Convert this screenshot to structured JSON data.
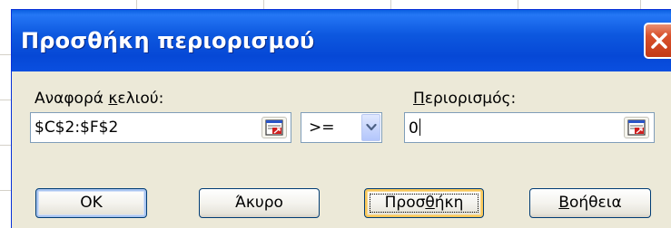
{
  "dialog": {
    "title": "Προσθήκη περιορισμού"
  },
  "cell_reference": {
    "label_pre": "Αναφορά ",
    "label_accel": "κ",
    "label_post": "ελιού:",
    "value": "$C$2:$F$2"
  },
  "operator": {
    "selected": ">="
  },
  "constraint": {
    "label_accel": "Π",
    "label_post": "εριορισμός:",
    "value": "0"
  },
  "buttons": {
    "ok": "OK",
    "cancel": "Άκυρο",
    "add_pre": "Προσ",
    "add_accel": "θ",
    "add_post": "ήκη",
    "help_accel": "Β",
    "help_post": "οήθεια"
  },
  "colors": {
    "titlebar": "#0a4fe0",
    "close_button": "#d9512c",
    "dialog_face": "#ece9d8",
    "field_border": "#7f9db9"
  },
  "icons": {
    "close": "close-x-icon",
    "collapse_dialog": "collapse-dialog-icon",
    "dropdown": "chevron-down-icon"
  }
}
